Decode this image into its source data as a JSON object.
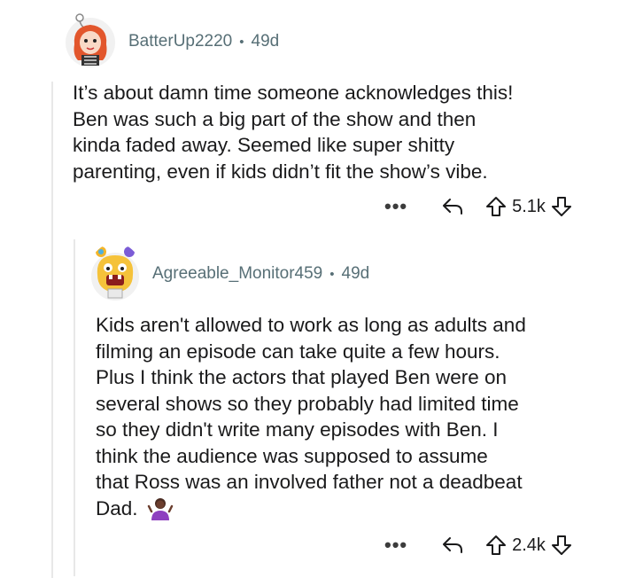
{
  "comments": [
    {
      "username": "BatterUp2220",
      "separator": "•",
      "age": "49d",
      "lines": [
        "It’s about damn time someone acknowledges this!",
        "Ben was such a big part of the show and then",
        "kinda faded away. Seemed like super shitty",
        "parenting, even if kids didn’t fit the show’s vibe."
      ],
      "more": "•••",
      "score": "5.1k"
    },
    {
      "username": "Agreeable_Monitor459",
      "separator": "•",
      "age": "49d",
      "lines": [
        "Kids aren't allowed to work as long as adults and",
        "filming an episode can take quite a few hours.",
        "Plus I think the actors that played Ben were on",
        "several shows so they probably had limited time",
        "so they didn't write many episodes with Ben. I",
        "think the audience was supposed to assume",
        "that Ross was an involved father not a deadbeat",
        "Dad."
      ],
      "more": "•••",
      "score": "2.4k"
    }
  ],
  "icons": {
    "reply": "reply-arrow-icon",
    "upvote": "upvote-arrow-icon",
    "downvote": "downvote-arrow-icon",
    "shrug": "shrug-emoji-icon"
  }
}
